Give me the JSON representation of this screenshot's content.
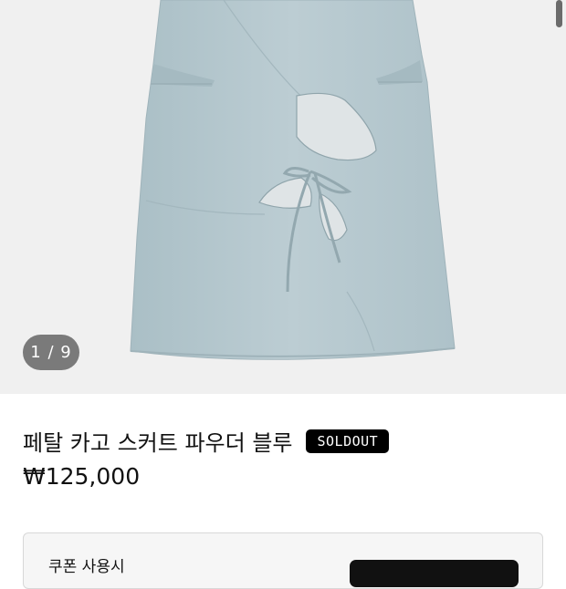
{
  "gallery": {
    "index": "1 / 9"
  },
  "product": {
    "title": "페탈 카고 스커트 파우더 블루",
    "badge": "SOLDOUT",
    "price": "₩125,000"
  },
  "coupon": {
    "label": "쿠폰 사용시"
  },
  "colors": {
    "skirt": "#b9cbd1",
    "background": "#f0f0f0",
    "badge": "#000000"
  }
}
